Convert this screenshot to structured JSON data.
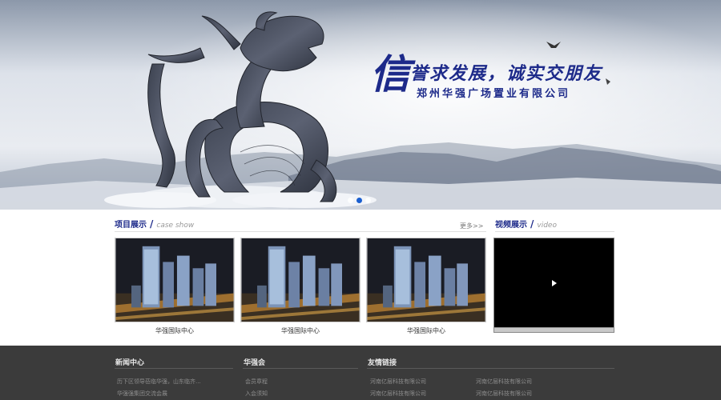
{
  "banner": {
    "slogan_big_char": "信",
    "slogan_main": "誉求发展，诚实交朋友",
    "slogan_sub": "郑州华强广场置业有限公司"
  },
  "projects": {
    "title": "项目展示",
    "slash": "/",
    "title_en": "case show",
    "more_label": "更多>>",
    "items": [
      {
        "caption": "华强国际中心"
      },
      {
        "caption": "华强国际中心"
      },
      {
        "caption": "华强国际中心"
      }
    ]
  },
  "video": {
    "title": "视频展示",
    "slash": "/",
    "title_en": "video"
  },
  "footer": {
    "news_title": "新闻中心",
    "news_items": [
      "历下区领导莅临华强，山东临齐...",
      "华强强集团交流会展"
    ],
    "club_title": "华强会",
    "club_items": [
      "会员章程",
      "入会须知"
    ],
    "links_title": "友情链接",
    "links_col1": [
      "河南亿层科技有限公司",
      "河南亿层科技有限公司"
    ],
    "links_col2": [
      "河南亿层科技有限公司",
      "河南亿层科技有限公司"
    ]
  },
  "colors": {
    "brand_blue": "#1d2a8a",
    "footer_bg": "#3b3b3b",
    "active_dot": "#1a5fd0"
  }
}
